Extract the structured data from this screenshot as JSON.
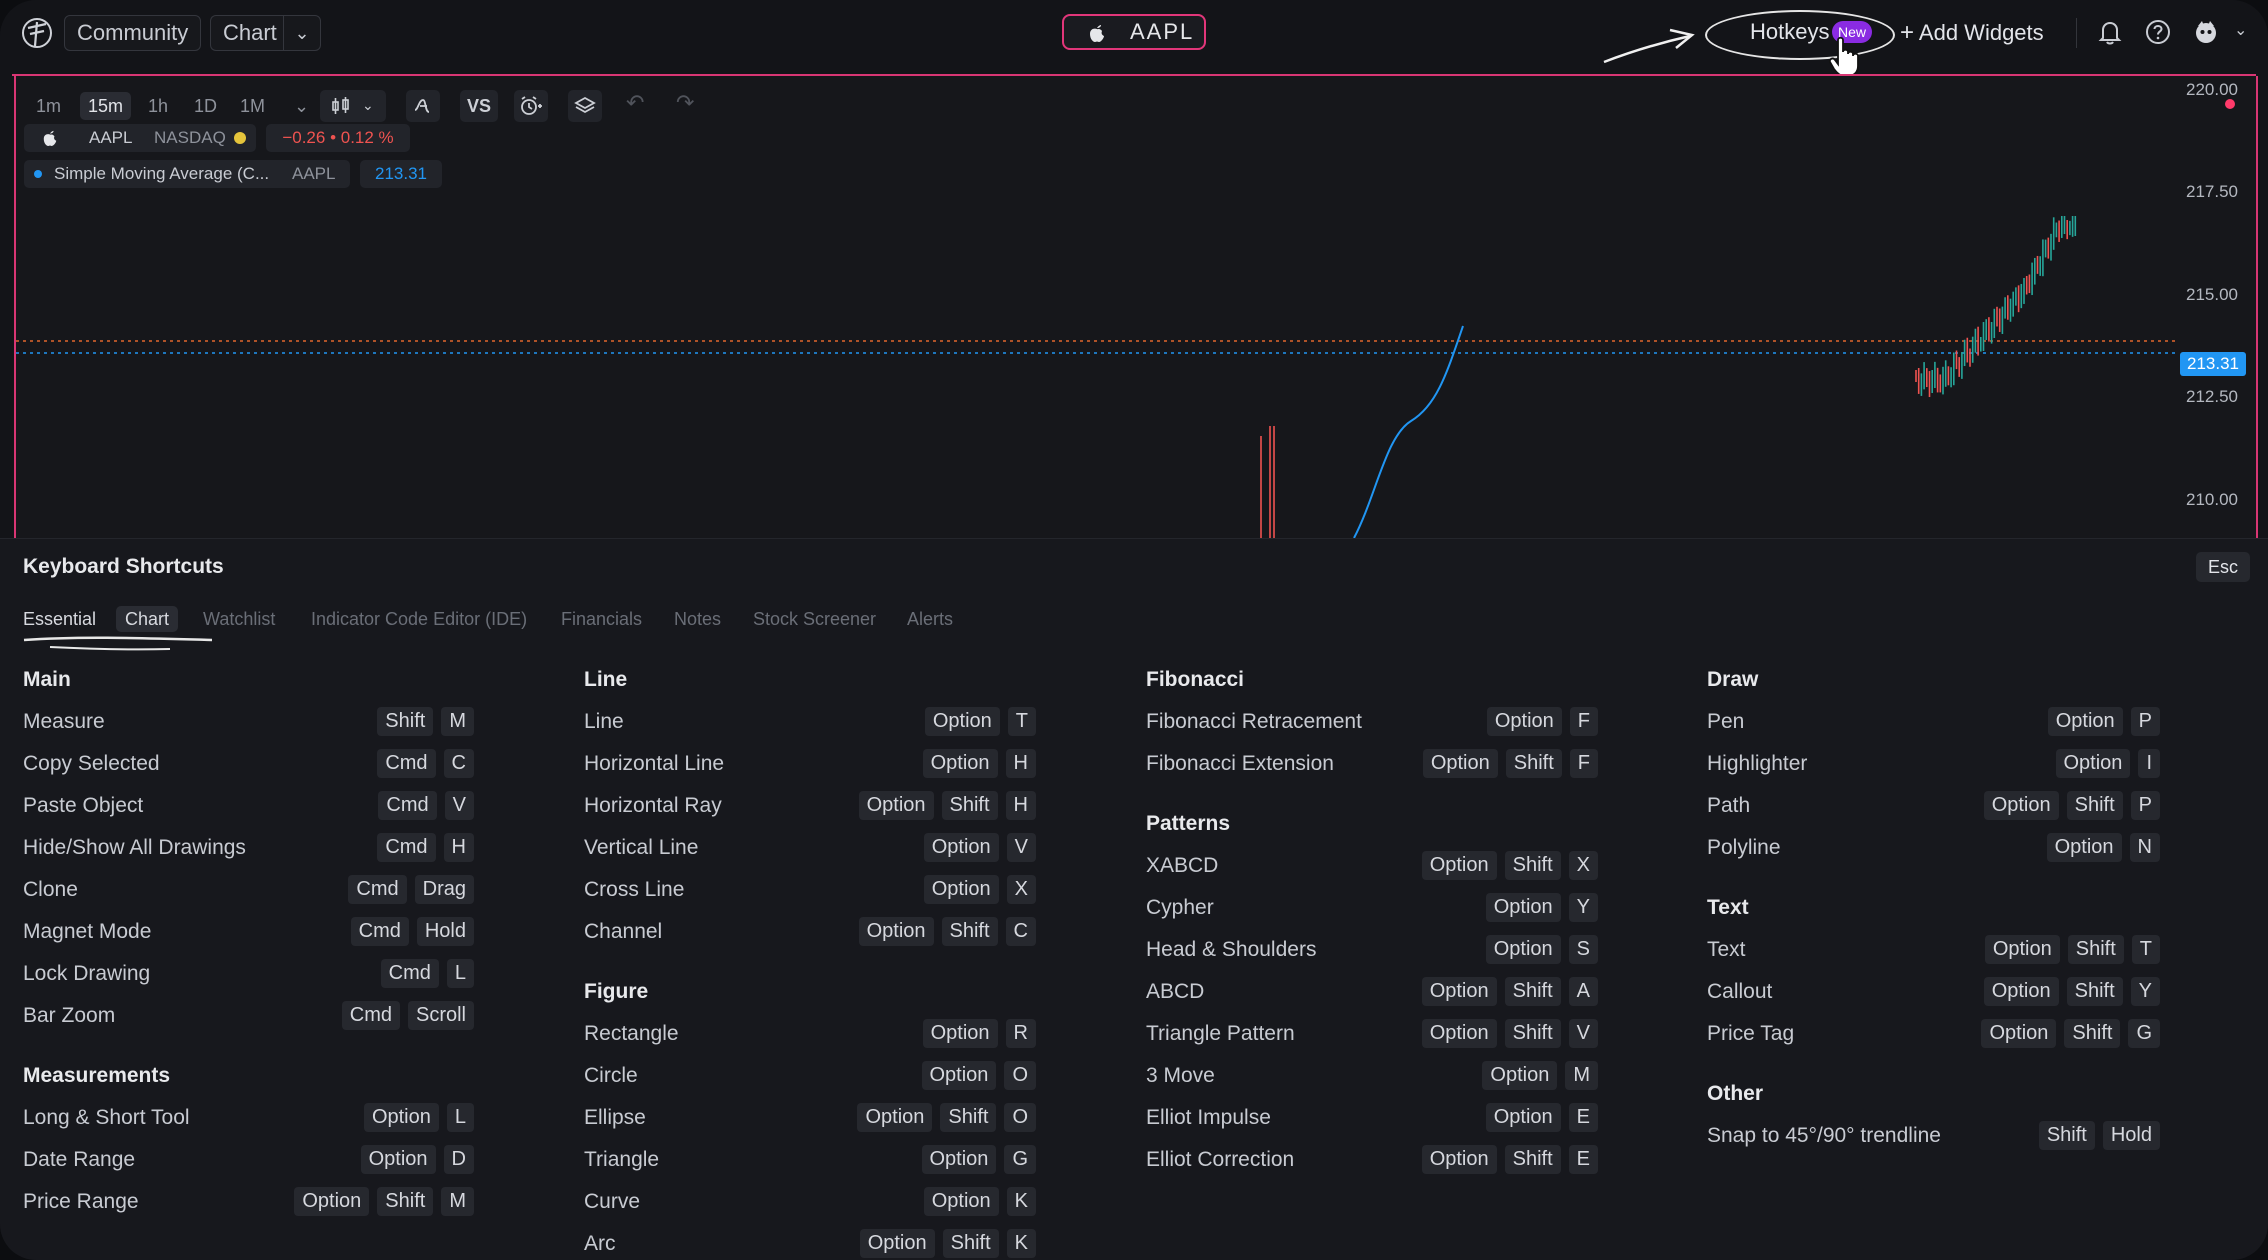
{
  "topbar": {
    "community": "Community",
    "chart": "Chart",
    "ticker": "AAPL",
    "hotkeys": "Hotkeys",
    "hotkeys_badge": "New",
    "add_widgets": "Add Widgets"
  },
  "chart_toolbar": {
    "timeframes": [
      "1m",
      "15m",
      "1h",
      "1D",
      "1M"
    ],
    "active_timeframe": "15m",
    "vs": "VS"
  },
  "legend": {
    "symbol": "AAPL",
    "exchange": "NASDAQ",
    "change": "−0.26 • 0.12 %",
    "indicator": "Simple Moving Average (C...",
    "indicator_symbol": "AAPL",
    "indicator_value": "213.31"
  },
  "price_axis": {
    "labels": [
      "220.00",
      "217.50",
      "215.00",
      "212.50",
      "210.00"
    ],
    "last_price": "213.31"
  },
  "colors": {
    "accent_pink": "#d93674",
    "price_blue": "#2196f3",
    "badge_purple": "#8a2be2",
    "up": "#26a69a",
    "down": "#ef5350"
  },
  "panel": {
    "title": "Keyboard Shortcuts",
    "esc": "Esc",
    "tabs": [
      "Essential",
      "Chart",
      "Watchlist",
      "Indicator Code Editor (IDE)",
      "Financials",
      "Notes",
      "Stock Screener",
      "Alerts"
    ],
    "sections": {
      "main": {
        "title": "Main",
        "items": [
          {
            "label": "Measure",
            "keys": [
              "Shift",
              "M"
            ]
          },
          {
            "label": "Copy Selected",
            "keys": [
              "Cmd",
              "C"
            ]
          },
          {
            "label": "Paste Object",
            "keys": [
              "Cmd",
              "V"
            ]
          },
          {
            "label": "Hide/Show All Drawings",
            "keys": [
              "Cmd",
              "H"
            ]
          },
          {
            "label": "Clone",
            "keys": [
              "Cmd",
              "Drag"
            ]
          },
          {
            "label": "Magnet Mode",
            "keys": [
              "Cmd",
              "Hold"
            ]
          },
          {
            "label": "Lock Drawing",
            "keys": [
              "Cmd",
              "L"
            ]
          },
          {
            "label": "Bar Zoom",
            "keys": [
              "Cmd",
              "Scroll"
            ]
          }
        ]
      },
      "measurements": {
        "title": "Measurements",
        "items": [
          {
            "label": "Long & Short Tool",
            "keys": [
              "Option",
              "L"
            ]
          },
          {
            "label": "Date Range",
            "keys": [
              "Option",
              "D"
            ]
          },
          {
            "label": "Price Range",
            "keys": [
              "Option",
              "Shift",
              "M"
            ]
          }
        ]
      },
      "line": {
        "title": "Line",
        "items": [
          {
            "label": "Line",
            "keys": [
              "Option",
              "T"
            ]
          },
          {
            "label": "Horizontal Line",
            "keys": [
              "Option",
              "H"
            ]
          },
          {
            "label": "Horizontal Ray",
            "keys": [
              "Option",
              "Shift",
              "H"
            ]
          },
          {
            "label": "Vertical Line",
            "keys": [
              "Option",
              "V"
            ]
          },
          {
            "label": "Cross Line",
            "keys": [
              "Option",
              "X"
            ]
          },
          {
            "label": "Channel",
            "keys": [
              "Option",
              "Shift",
              "C"
            ]
          }
        ]
      },
      "figure": {
        "title": "Figure",
        "items": [
          {
            "label": "Rectangle",
            "keys": [
              "Option",
              "R"
            ]
          },
          {
            "label": "Circle",
            "keys": [
              "Option",
              "O"
            ]
          },
          {
            "label": "Ellipse",
            "keys": [
              "Option",
              "Shift",
              "O"
            ]
          },
          {
            "label": "Triangle",
            "keys": [
              "Option",
              "G"
            ]
          },
          {
            "label": "Curve",
            "keys": [
              "Option",
              "K"
            ]
          },
          {
            "label": "Arc",
            "keys": [
              "Option",
              "Shift",
              "K"
            ]
          }
        ]
      },
      "fibonacci": {
        "title": "Fibonacci",
        "items": [
          {
            "label": "Fibonacci Retracement",
            "keys": [
              "Option",
              "F"
            ]
          },
          {
            "label": "Fibonacci Extension",
            "keys": [
              "Option",
              "Shift",
              "F"
            ]
          }
        ]
      },
      "patterns": {
        "title": "Patterns",
        "items": [
          {
            "label": "XABCD",
            "keys": [
              "Option",
              "Shift",
              "X"
            ]
          },
          {
            "label": "Cypher",
            "keys": [
              "Option",
              "Y"
            ]
          },
          {
            "label": "Head & Shoulders",
            "keys": [
              "Option",
              "S"
            ]
          },
          {
            "label": "ABCD",
            "keys": [
              "Option",
              "Shift",
              "A"
            ]
          },
          {
            "label": "Triangle Pattern",
            "keys": [
              "Option",
              "Shift",
              "V"
            ]
          },
          {
            "label": "3 Move",
            "keys": [
              "Option",
              "M"
            ]
          },
          {
            "label": "Elliot Impulse",
            "keys": [
              "Option",
              "E"
            ]
          },
          {
            "label": "Elliot Correction",
            "keys": [
              "Option",
              "Shift",
              "E"
            ]
          }
        ]
      },
      "draw": {
        "title": "Draw",
        "items": [
          {
            "label": "Pen",
            "keys": [
              "Option",
              "P"
            ]
          },
          {
            "label": "Highlighter",
            "keys": [
              "Option",
              "I"
            ]
          },
          {
            "label": "Path",
            "keys": [
              "Option",
              "Shift",
              "P"
            ]
          },
          {
            "label": "Polyline",
            "keys": [
              "Option",
              "N"
            ]
          }
        ]
      },
      "text": {
        "title": "Text",
        "items": [
          {
            "label": "Text",
            "keys": [
              "Option",
              "Shift",
              "T"
            ]
          },
          {
            "label": "Callout",
            "keys": [
              "Option",
              "Shift",
              "Y"
            ]
          },
          {
            "label": "Price Tag",
            "keys": [
              "Option",
              "Shift",
              "G"
            ]
          }
        ]
      },
      "other": {
        "title": "Other",
        "items": [
          {
            "label": "Snap to 45°/90° trendline",
            "keys": [
              "Shift",
              "Hold"
            ]
          }
        ]
      }
    }
  }
}
